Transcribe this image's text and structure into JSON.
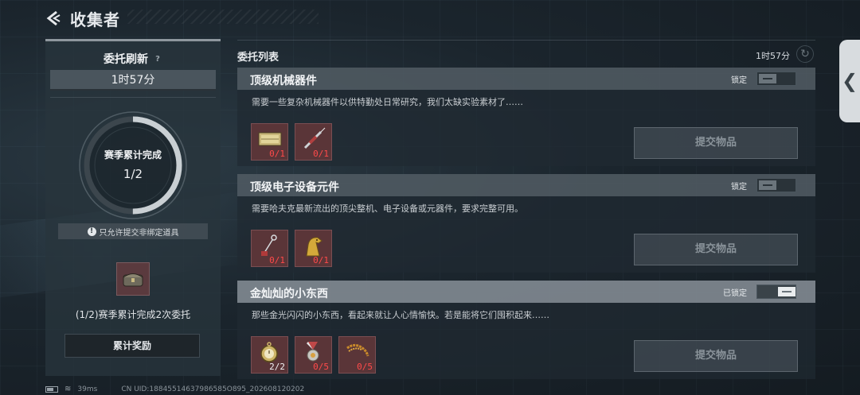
{
  "header": {
    "title": "收集者"
  },
  "left_panel": {
    "refresh_title": "委托刷新",
    "help_mark": "?",
    "timer": "1时57分",
    "season_label": "赛季累计完成",
    "season_progress": "1/2",
    "season_progress_fraction": 0.5,
    "notice": "只允许提交非绑定道具",
    "notice_icon": "!",
    "reward_desc": "(1/2)赛季累计完成2次委托",
    "claim_button": "累计奖励"
  },
  "list": {
    "title": "委托列表",
    "timer": "1时57分",
    "cards": [
      {
        "title": "顶级机械器件",
        "lock_label": "锁定",
        "locked": false,
        "desc": "需要一些复杂机械器件以供特勤处日常研究，我们太缺实验素材了……",
        "items": [
          {
            "icon": "gold-box-icon",
            "count": "0/1",
            "done": false
          },
          {
            "icon": "syringe-icon",
            "count": "0/1",
            "done": false
          }
        ],
        "submit": "提交物品"
      },
      {
        "title": "顶级电子设备元件",
        "lock_label": "锁定",
        "locked": false,
        "desc": "需要哈夫克最新流出的顶尖整机、电子设备或元器件，要求完整可用。",
        "items": [
          {
            "icon": "pendant-icon",
            "count": "0/1",
            "done": false
          },
          {
            "icon": "golden-horse-icon",
            "count": "0/1",
            "done": false
          }
        ],
        "submit": "提交物品"
      },
      {
        "title": "金灿灿的小东西",
        "lock_label": "已锁定",
        "locked": true,
        "desc": "那些金光闪闪的小东西，看起来就让人心情愉快。若是能将它们囤积起来……",
        "items": [
          {
            "icon": "pocket-watch-icon",
            "count": "2/2",
            "done": true
          },
          {
            "icon": "medal-icon",
            "count": "0/5",
            "done": false
          },
          {
            "icon": "gold-chain-icon",
            "count": "0/5",
            "done": false
          }
        ],
        "submit": "提交物品"
      }
    ]
  },
  "status_bar": {
    "ping": "39ms",
    "uid": "CN UID:18845514637986585O895_202608120202"
  },
  "colors": {
    "missing_count": "#ff4a4a",
    "slot_bg": "#5a3538",
    "panel_bg": "#28343c"
  }
}
